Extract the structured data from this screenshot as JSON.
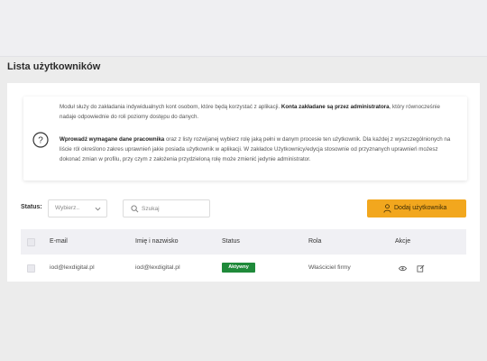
{
  "page": {
    "title": "Lista użytkowników"
  },
  "info": {
    "p1_part1": "Moduł służy do zakładania indywidualnych kont osobom, które będą korzystać z aplikacji. ",
    "p1_bold1": "Konta zakładane są przez administratora",
    "p1_part2": ", który równocześnie nadaje odpowiednie do roli poziomy dostępu do danych.",
    "p2_bold1": "Wprowadź wymagane dane pracownika",
    "p2_part1": " oraz z listy rozwijanej wybierz rolę jaką pełni w danym procesie ten użytkownik. Dla każdej z wyszczególnionych na liście ról określono zakres uprawnień jakie posiada użytkownik w aplikacji. W zakładce Użytkownicy/edycja stosownie od przyznanych uprawnień możesz dokonać zmian w profilu, przy czym z założenia przydzieloną rolę może zmienić jedynie administrator."
  },
  "filters": {
    "status_label": "Status:",
    "status_value": "Wybierz..",
    "search_placeholder": "Szukaj"
  },
  "actions": {
    "add_user": "Dodaj użytkownika"
  },
  "table": {
    "headers": [
      "E-mail",
      "Imię i nazwisko",
      "Status",
      "Rola",
      "Akcje"
    ],
    "rows": [
      {
        "email": "iod@lexdigital.pl",
        "name": "iod@lexdigital.pl",
        "status": "Aktywny",
        "role": "Właściciel firmy"
      }
    ]
  },
  "icons": {
    "help": "question-circle-icon",
    "chevron": "chevron-down-icon",
    "search": "search-icon",
    "user": "user-icon",
    "view": "eye-icon",
    "edit": "edit-icon"
  },
  "colors": {
    "accent": "#f2a71e",
    "status_active": "#1f8a3a",
    "header_bg": "#f0f0f4"
  }
}
